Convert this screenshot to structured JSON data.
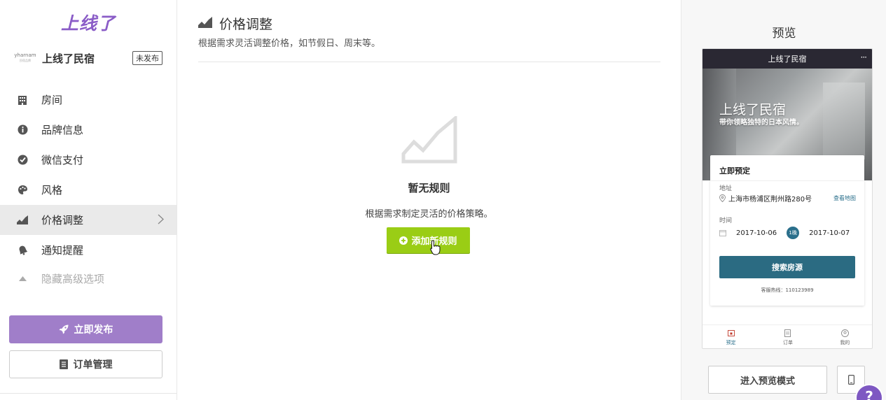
{
  "sidebar": {
    "logo": "上线了",
    "brand": {
      "mini_line1": "yharnam",
      "mini_line2": "民宿品牌",
      "name": "上线了民宿",
      "status": "未发布"
    },
    "items": [
      {
        "label": "房间",
        "icon": "building-icon"
      },
      {
        "label": "品牌信息",
        "icon": "info-icon"
      },
      {
        "label": "微信支付",
        "icon": "wechat-pay-icon"
      },
      {
        "label": "风格",
        "icon": "palette-icon"
      },
      {
        "label": "价格调整",
        "icon": "chart-area-icon",
        "active": true
      },
      {
        "label": "通知提醒",
        "icon": "bell-icon"
      },
      {
        "label": "隐藏高级选项",
        "icon": "caret-up-icon",
        "muted": true
      }
    ],
    "publish_label": "立即发布",
    "orders_label": "订单管理"
  },
  "main": {
    "title": "价格调整",
    "description": "根据需求灵活调整价格，如节假日、周末等。",
    "empty": {
      "title": "暂无规则",
      "description": "根据需求制定灵活的价格策略。",
      "add_button": "添加新规则"
    }
  },
  "preview": {
    "title": "预览",
    "phone": {
      "header": "上线了民宿",
      "menu": "···",
      "hero_title": "上线了民宿",
      "hero_subtitle": "带你领略独特的日本风情。",
      "card_title": "立即预定",
      "address_label": "地址",
      "address": "上海市杨浦区荆州路280号",
      "map_link": "查看地图",
      "time_label": "时间",
      "checkin": "2017-10-06",
      "nights": "1晚",
      "checkout": "2017-10-07",
      "search_button": "搜索房源",
      "hotline": "客服热线：110123989",
      "tabs": [
        {
          "label": "预定",
          "active": true
        },
        {
          "label": "订单"
        },
        {
          "label": "我的"
        }
      ]
    },
    "enter_preview_button": "进入预览模式"
  },
  "help_label": "?",
  "colors": {
    "brand_purple": "#8a5cc7",
    "publish_button": "#a07ec9",
    "add_button_green": "#9acd15",
    "preview_teal": "#2b6b82",
    "phone_header": "#2a2833"
  }
}
